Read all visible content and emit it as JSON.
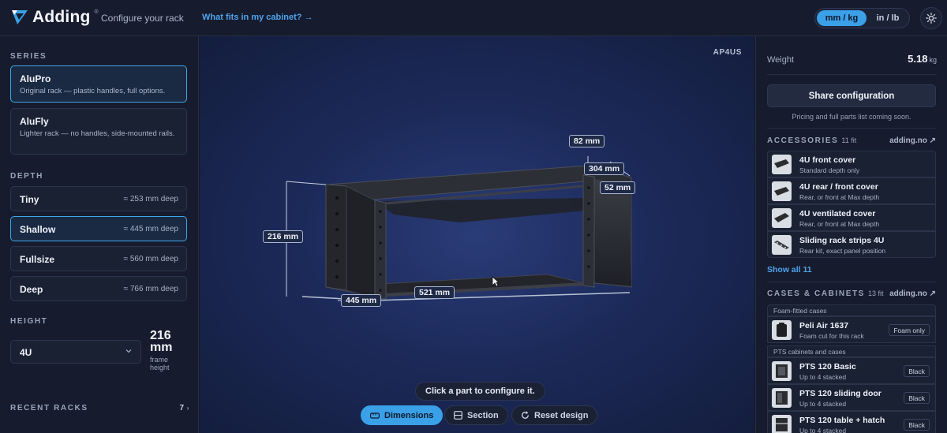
{
  "header": {
    "logo_text": "Adding",
    "logo_reg": "®",
    "configure_label": "Configure your rack",
    "fits_link": "What fits in my cabinet? →",
    "units": {
      "metric": "mm / kg",
      "imperial": "in / lb",
      "selected": "metric"
    },
    "theme_icon": "sun-icon"
  },
  "sidebar": {
    "series_title": "SERIES",
    "series": [
      {
        "name": "AluPro",
        "desc": "Original rack — plastic handles, full options.",
        "selected": true
      },
      {
        "name": "AluFly",
        "desc": "Lighter rack — no handles, side-mounted rails.",
        "selected": false
      }
    ],
    "depth_title": "DEPTH",
    "depths": [
      {
        "name": "Tiny",
        "value": "≈ 253 mm deep",
        "selected": false
      },
      {
        "name": "Shallow",
        "value": "≈ 445 mm deep",
        "selected": true
      },
      {
        "name": "Fullsize",
        "value": "≈ 560 mm deep",
        "selected": false
      },
      {
        "name": "Deep",
        "value": "≈ 766 mm deep",
        "selected": false
      }
    ],
    "height_title": "HEIGHT",
    "height_value": "4U",
    "height_mm": "216 mm",
    "height_sub": "frame height",
    "recent_title": "RECENT RACKS",
    "recent_count": "7"
  },
  "viewport": {
    "model_code": "AP4US",
    "dimensions": {
      "top_depth": "82 mm",
      "top_width": "304 mm",
      "top_side": "52 mm",
      "height": "216 mm",
      "depth": "445 mm",
      "width": "521 mm"
    },
    "hint": "Click a part to configure it.",
    "buttons": [
      {
        "label": "Dimensions",
        "icon": "ruler-icon",
        "active": true
      },
      {
        "label": "Section",
        "icon": "section-icon",
        "active": false
      },
      {
        "label": "Reset design",
        "icon": "reset-icon",
        "active": false
      }
    ]
  },
  "right": {
    "weight_label": "Weight",
    "weight_value": "5.18",
    "weight_unit": "kg",
    "share_label": "Share configuration",
    "pricing_note": "Pricing and full parts list coming soon.",
    "accessories": {
      "title": "ACCESSORIES",
      "count": "11 fit",
      "link": "adding.no ↗",
      "items": [
        {
          "name": "4U front cover",
          "sub": "Standard depth only"
        },
        {
          "name": "4U rear / front cover",
          "sub": "Rear, or front at Max depth"
        },
        {
          "name": "4U ventilated cover",
          "sub": "Rear, or front at Max depth"
        },
        {
          "name": "Sliding rack strips 4U",
          "sub": "Rear kit, exact panel position"
        }
      ],
      "show_all": "Show all 11"
    },
    "cases": {
      "title": "CASES & CABINETS",
      "count": "13 fit",
      "link": "adding.no ↗",
      "group_foam": "Foam-fitted cases",
      "foam_items": [
        {
          "name": "Peli Air 1637",
          "sub": "Foam cut for this rack",
          "tag": "Foam only"
        }
      ],
      "group_pts": "PTS cabinets and cases",
      "pts_items": [
        {
          "name": "PTS 120 Basic",
          "sub": "Up to 4 stacked",
          "tag": "Black"
        },
        {
          "name": "PTS 120 sliding door",
          "sub": "Up to 4 stacked",
          "tag": "Black"
        },
        {
          "name": "PTS 120 table + hatch",
          "sub": "Up to 4 stacked",
          "tag": "Black"
        }
      ]
    }
  },
  "colors": {
    "accent": "#3aa0e8",
    "link": "#4fa3ee",
    "background": "#141a2b",
    "panel": "#161c2d"
  }
}
